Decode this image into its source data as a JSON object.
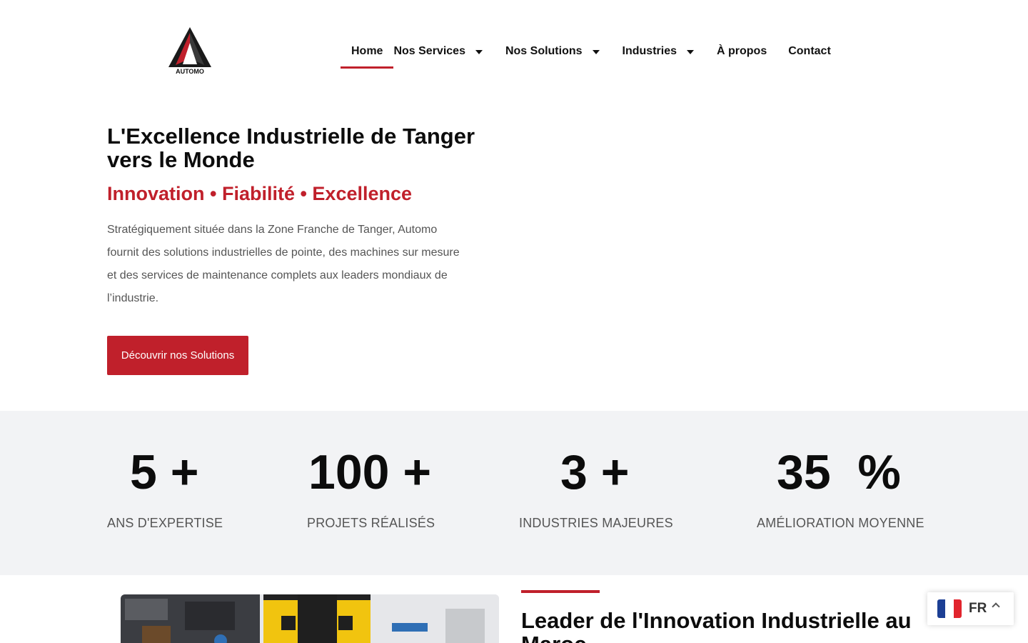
{
  "brand": {
    "logo_text": "AUTOMO",
    "accent_color": "#c0202b"
  },
  "nav": {
    "home": "Home",
    "services": "Nos Services",
    "solutions": "Nos Solutions",
    "industries": "Industries",
    "about": "À propos",
    "contact": "Contact",
    "active": "Home"
  },
  "hero": {
    "title": "L'Excellence Industrielle de Tanger vers le Monde",
    "tagline": "Innovation • Fiabilité • Excellence",
    "description": "Stratégiquement située dans la Zone Franche de Tanger, Automo fournit des solutions industrielles de pointe, des machines sur mesure et des services de maintenance complets aux leaders mondiaux de l’industrie.",
    "cta_label": "Découvrir nos Solutions"
  },
  "stats": [
    {
      "value": "5 +",
      "label": "ANS D'EXPERTISE"
    },
    {
      "value": "100 +",
      "label": "PROJETS RÉALISÉS"
    },
    {
      "value": "3 +",
      "label": "INDUSTRIES MAJEURES"
    },
    {
      "value": "35  %",
      "label": "AMÉLIORATION MOYENNE"
    }
  ],
  "section": {
    "title": "Leader de l'Innovation Industrielle au Maroc"
  },
  "language": {
    "code": "FR",
    "flag": "france-flag-icon"
  }
}
